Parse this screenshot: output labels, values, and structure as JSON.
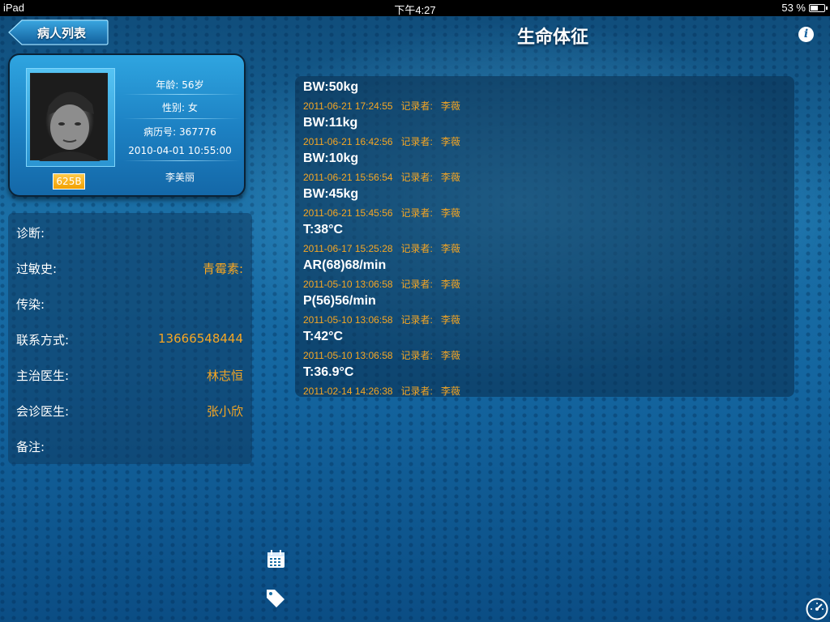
{
  "status_bar": {
    "device": "iPad",
    "time": "下午4:27",
    "battery": "53 %"
  },
  "header": {
    "back_label": "病人列表",
    "title": "生命体征",
    "info_icon": "info-icon"
  },
  "patient": {
    "age_label": "年龄:",
    "age": "56岁",
    "sex_label": "性别:",
    "sex": "女",
    "record_label": "病历号:",
    "record_no": "367776",
    "datetime": "2010-04-01 10:55:00",
    "name": "李美丽",
    "bed": "625B"
  },
  "details": {
    "diagnosis_label": "诊断:",
    "diagnosis": "",
    "allergy_label": "过敏史:",
    "allergy": "青霉素:",
    "infection_label": "传染:",
    "infection": "",
    "contact_label": "联系方式:",
    "contact": "13666548444",
    "doctor_label": "主治医生:",
    "doctor": "林志恒",
    "consult_label": "会诊医生:",
    "consult": "张小欣",
    "remarks_label": "备注:",
    "remarks": ""
  },
  "vitals": [
    {
      "value": "BW:50kg",
      "time": "2011-06-21 17:24:55",
      "recorder_label": "记录者:",
      "recorder": "李薇"
    },
    {
      "value": "BW:11kg",
      "time": "2011-06-21 16:42:56",
      "recorder_label": "记录者:",
      "recorder": "李薇"
    },
    {
      "value": "BW:10kg",
      "time": "2011-06-21 15:56:54",
      "recorder_label": "记录者:",
      "recorder": "李薇"
    },
    {
      "value": "BW:45kg",
      "time": "2011-06-21 15:45:56",
      "recorder_label": "记录者:",
      "recorder": "李薇"
    },
    {
      "value": "T:38°C",
      "time": "2011-06-17 15:25:28",
      "recorder_label": "记录者:",
      "recorder": "李薇"
    },
    {
      "value": "AR(68)68/min",
      "time": "2011-05-10 13:06:58",
      "recorder_label": "记录者:",
      "recorder": "李薇"
    },
    {
      "value": "P(56)56/min",
      "time": "2011-05-10 13:06:58",
      "recorder_label": "记录者:",
      "recorder": "李薇"
    },
    {
      "value": "T:42°C",
      "time": "2011-05-10 13:06:58",
      "recorder_label": "记录者:",
      "recorder": "李薇"
    },
    {
      "value": "T:36.9°C",
      "time": "2011-02-14 14:26:38",
      "recorder_label": "记录者:",
      "recorder": "李薇"
    }
  ],
  "toolbar": {
    "calendar_icon": "calendar-icon",
    "tag_icon": "tag-icon",
    "dashboard_icon": "dashboard-icon"
  },
  "colors": {
    "accent": "#f6a623",
    "background": "#1a6fa6"
  }
}
